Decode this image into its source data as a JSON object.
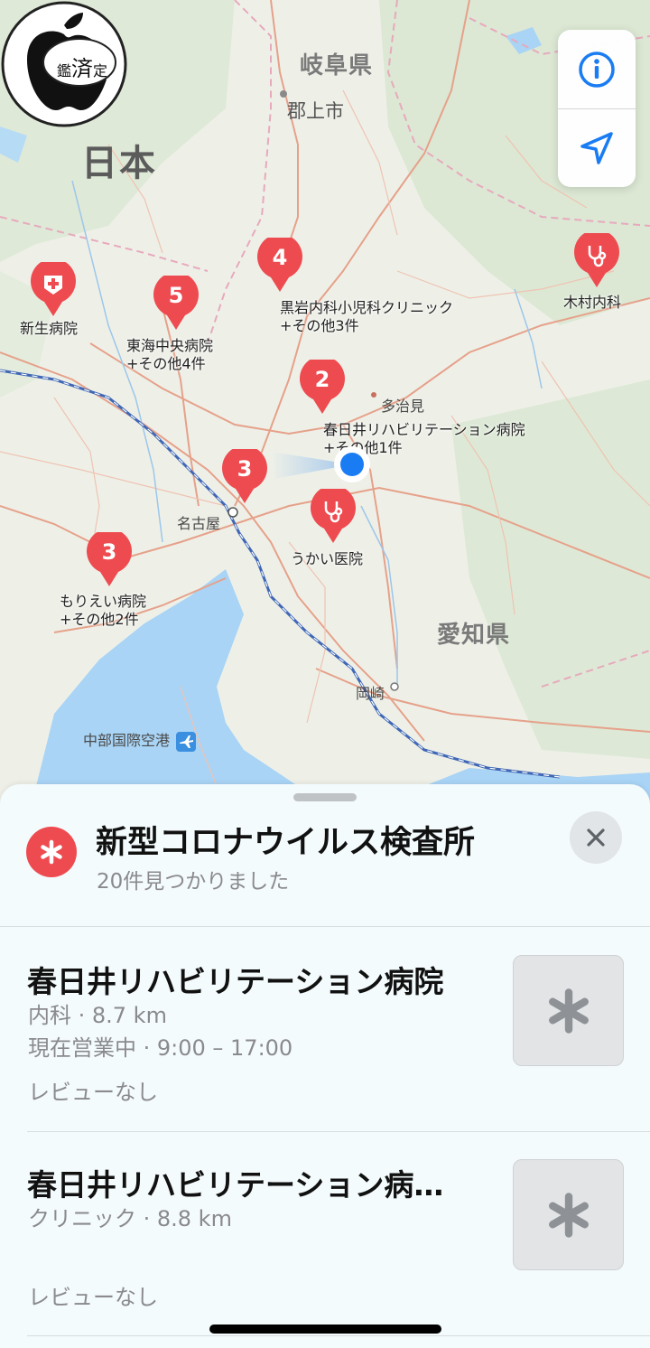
{
  "map": {
    "labels": {
      "country": "日本",
      "gifu": "岐阜県",
      "gujo": "郡上市",
      "aichi": "愛知県",
      "tajimi": "多治見",
      "nagoya": "名古屋",
      "okazaki": "岡崎",
      "airport": "中部国際空港"
    },
    "pins": [
      {
        "id": "shinsei",
        "type": "hospital",
        "label": "新生病院",
        "sub": ""
      },
      {
        "id": "tokai",
        "type": "cluster",
        "count": "5",
        "label": "東海中央病院",
        "sub": "+その他4件"
      },
      {
        "id": "kuroiwa",
        "type": "cluster",
        "count": "4",
        "label": "黒岩内科小児科クリニック",
        "sub": "+その他3件"
      },
      {
        "id": "kimura",
        "type": "doctor",
        "label": "木村内科",
        "sub": ""
      },
      {
        "id": "kasugai",
        "type": "cluster",
        "count": "2",
        "label": "春日井リハビリテーション病院",
        "sub": "+その他1件"
      },
      {
        "id": "cluster3",
        "type": "cluster",
        "count": "3",
        "label": "",
        "sub": ""
      },
      {
        "id": "ukai",
        "type": "doctor",
        "label": "うかい医院",
        "sub": ""
      },
      {
        "id": "morie",
        "type": "cluster",
        "count": "3",
        "label": "もりえい病院",
        "sub": "+その他2件"
      }
    ],
    "badge": {
      "text_left": "鑑",
      "text_mid": "済",
      "text_right": "定"
    },
    "colors": {
      "pin_red": "#ee4b50",
      "user_blue": "#1a7cf3",
      "water": "#a9d4f5",
      "rail": "#3f67b5"
    }
  },
  "controls": {
    "info_icon": "info-icon",
    "location_icon": "location-arrow-icon"
  },
  "sheet": {
    "category_title": "新型コロナウイルス検査所",
    "category_count": "20件見つかりました",
    "close_icon": "close-icon"
  },
  "results": [
    {
      "name": "春日井リハビリテーション病院",
      "category_distance": "内科 · 8.7 km",
      "hours": "現在営業中 · 9:00 – 17:00",
      "reviews": "レビューなし"
    },
    {
      "name": "春日井リハビリテーション病…",
      "category_distance": "クリニック · 8.8 km",
      "hours": "",
      "reviews": "レビューなし"
    }
  ]
}
